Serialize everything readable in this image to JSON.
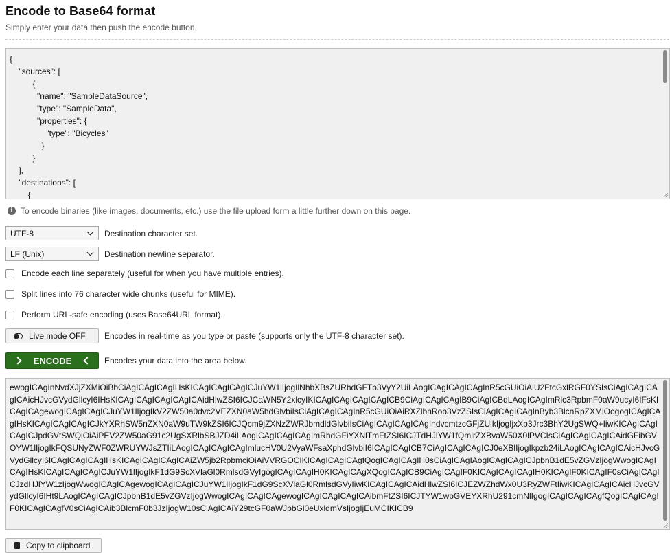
{
  "header": {
    "title": "Encode to Base64 format",
    "subtitle": "Simply enter your data then push the encode button."
  },
  "input": {
    "lines": [
      "{",
      "    \"sources\": [",
      "          {",
      "            \"name\": \"SampleDataSource\",",
      "            \"type\": \"SampleData\",",
      "            \"properties\": {",
      "                \"type\": \"Bicycles\"",
      "              }",
      "          }",
      "    ],",
      "    \"destinations\": [",
      "        {"
    ]
  },
  "info": {
    "icon": "info-icon",
    "text": "To encode binaries (like images, documents, etc.) use the file upload form a little further down on this page."
  },
  "options": {
    "charset": {
      "value": "UTF-8",
      "label": "Destination character set."
    },
    "newline": {
      "value": "LF (Unix)",
      "label": "Destination newline separator."
    },
    "each_line": {
      "checked": false,
      "label": "Encode each line separately (useful for when you have multiple entries)."
    },
    "split_lines": {
      "checked": false,
      "label": "Split lines into 76 character wide chunks (useful for MIME)."
    },
    "url_safe": {
      "checked": false,
      "label": "Perform URL-safe encoding (uses Base64URL format)."
    }
  },
  "live_mode": {
    "button_label": "Live mode OFF",
    "description": "Encodes in real-time as you type or paste (supports only the UTF-8 character set)."
  },
  "encode": {
    "button_label": "ENCODE",
    "description": "Encodes your data into the area below."
  },
  "output": {
    "text": "ewogICAgInNvdXJjZXMiOiBbCiAgICAgICAgIHsKICAgICAgICAgICJuYW1lIjogIlNhbXBsZURhdGFTb3VyY2UiLAogICAgICAgICAgInR5cGUiOiAiU2FtcGxlRGF0YSIsCiAgICAgICAgICAicHJvcGVydGllcyI6IHsKICAgICAgICAgICAgICAidHlwZSI6ICJCaWN5Y2xlcyIKICAgICAgICAgICAgICB9CiAgICAgICAgIB9CiAgICBdLAogICAgImRlc3RpbmF0aW9ucyI6IFsKICAgICAgewogICAgICAgICJuYW1lIjogIkV2ZW50a0dvc2VEZXN0aW5hdGlvbiIsCiAgICAgICAgInR5cGUiOiAiRXZlbnRob3VzZSIsCiAgICAgICAgInByb3BlcnRpZXMiOogogICAgICAgIHsKICAgICAgICAgICJkYXRhSW5nZXN0aW9uTW9kZSI6ICJQcm9jZXNzZWRJbmdldGlvbiIsCiAgICAgICAgICAgIndvcmtzcGFjZUlkIjogIjxXb3Jrc3BhY2UgSWQ+IiwKICAgICAgICAgICJpdGVtSWQiOiAiPEV2ZW50aG91c2UgSXRlbSBJZD4iLAogICAgICAgICAgImRhdGFiYXNlTmFtZSI6ICJTdHJlYW1fQmlrZXBvaW50X0lPVCIsCiAgICAgICAgICAidGFibGVOYW1lIjogIkFQSUNyZWF0ZWRUYWJsZTIiLAogICAgICAgICAgImlucHV0U2VyaWFsaXphdGlvbiI6ICAgICAgICB7CiAgICAgICAgICJ0eXBlIjogIkpzb24iLAogICAgICAgICAicHJvcGVydGllcyI6ICAgICAgICAgIHsKICAgICAgICAgICAiZW5jb2RpbmciOiAiVVRGOCIKICAgICAgICAgfQogICAgICAgIH0sCiAgICAgIAogICAgICAgICJpbnB1dE5vZGVzIjogWwogICAgICAgIHsKICAgICAgICAgICJuYW1lIjogIkF1dG9ScXVlaGl0RmlsdGVyIgogICAgICAgIH0KICAgICAgXQogICAgICB9CiAgICAgIF0KICAgICAgICAgIH0KICAgIF0KICAgIF0sCiAgICAgICJzdHJlYW1zIjogWwogICAgICAgewogICAgICAgICJuYW1lIjogIkF1dG9ScXVlaGl0RmlsdGVyIiwKICAgICAgICAidHlwZSI6ICJEZWZhdWx0U3RyZWFtIiwKICAgICAgICAicHJvcGVydGllcyI6IHt9LAogICAgICAgICJpbnB1dE5vZGVzIjogWwogICAgICAgICAgewogICAgICAgICAgICAibmFtZSI6ICJTYW1wbGVEYXRhU291cmNlIgogICAgICAgICAgfQogICAgICAgIF0KICAgICAgfV0sCiAgICAib3BlcmF0b3JzIjogW10sCiAgICAiY29tcGF0aWJpbGl0eUxldmVsIjogIjEuMCIKICB9"
  },
  "copy": {
    "button_label": "Copy to clipboard"
  }
}
